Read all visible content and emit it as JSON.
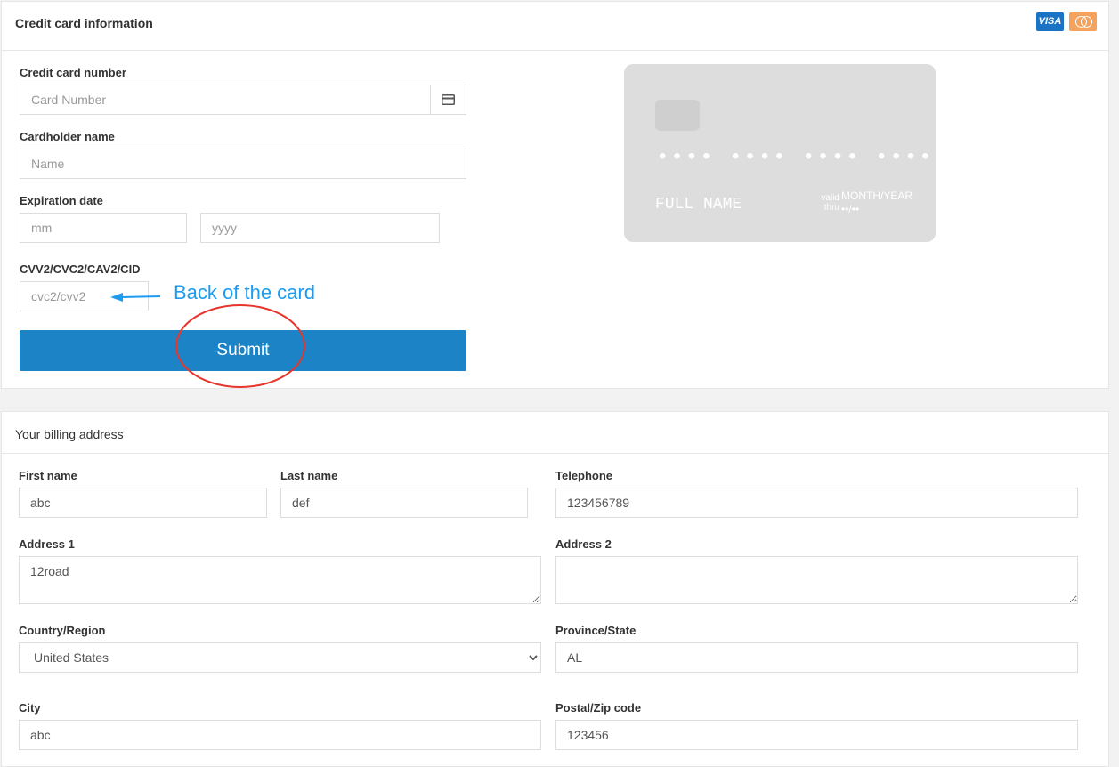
{
  "cc": {
    "title": "Credit card information",
    "brands": {
      "visa": "VISA",
      "mastercard_icon": "mastercard-icon"
    },
    "card_number_label": "Credit card number",
    "card_number_placeholder": "Card Number",
    "card_icon": "credit-card-icon",
    "cardholder_label": "Cardholder name",
    "cardholder_placeholder": "Name",
    "expiration_label": "Expiration date",
    "month_placeholder": "mm",
    "year_placeholder": "yyyy",
    "cvv_label": "CVV2/CVC2/CAV2/CID",
    "cvv_placeholder": "cvc2/cvv2",
    "submit_label": "Submit",
    "annotation_text": "Back of the card",
    "preview": {
      "number": "•••• •••• •••• ••••",
      "name": "FULL NAME",
      "valid_thru": "valid thru",
      "expiry_label": "MONTH/YEAR",
      "expiry_value": "••/••"
    }
  },
  "billing": {
    "title": "Your billing address",
    "first_name_label": "First name",
    "first_name_value": "abc",
    "last_name_label": "Last name",
    "last_name_value": "def",
    "telephone_label": "Telephone",
    "telephone_value": "123456789",
    "address1_label": "Address 1",
    "address1_value": "12road",
    "address2_label": "Address 2",
    "address2_value": "",
    "country_label": "Country/Region",
    "country_value": "United States",
    "province_label": "Province/State",
    "province_value": "AL",
    "city_label": "City",
    "city_value": "abc",
    "postal_label": "Postal/Zip code",
    "postal_value": "123456"
  },
  "colors": {
    "primary": "#1c84c6",
    "annotation_blue": "#1d9bf0",
    "annotation_red": "#e8352b"
  }
}
